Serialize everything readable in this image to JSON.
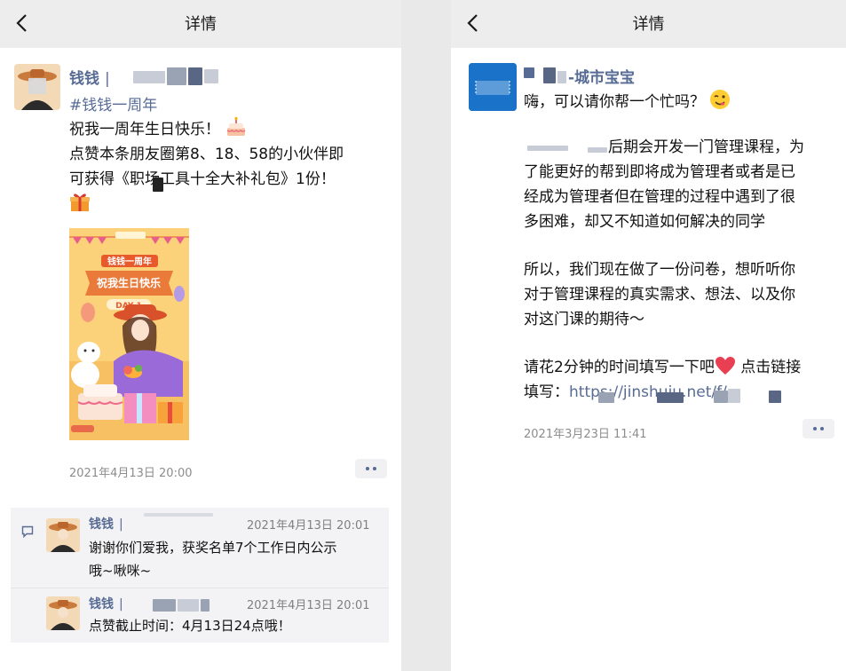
{
  "left": {
    "nav": {
      "title": "详情"
    },
    "post": {
      "author": "钱钱",
      "separator": "|",
      "hashtag": "#钱钱一周年",
      "lines": [
        "祝我一周年生日快乐！",
        "点赞本条朋友圈第8、18、58的小伙伴即",
        "可获得《职场工具十全大补礼包》1份！"
      ],
      "poster": {
        "badge": "钱钱一周年",
        "banner": "祝我生日快乐",
        "day": "DAY 1"
      },
      "time": "2021年4月13日 20:00"
    },
    "comments": [
      {
        "author": "钱钱",
        "separator": "|",
        "time": "2021年4月13日 20:01",
        "lines": [
          "谢谢你们爱我，获奖名单7个工作日内公示",
          "哦~啾咪~"
        ]
      },
      {
        "author": "钱钱",
        "separator": "|",
        "time": "2021年4月13日 20:01",
        "lines": [
          "点赞截止时间：4月13日24点哦！"
        ]
      }
    ]
  },
  "right": {
    "nav": {
      "title": "详情"
    },
    "post": {
      "author_suffix": "-城市宝宝",
      "greeting": "嗨，可以请你帮一个忙吗？",
      "para1": [
        "后期会开发一门管理课程，为",
        "了能更好的帮到即将成为管理者或者是已",
        "经成为管理者但在管理的过程中遇到了很",
        "多困难，却又不知道如何解决的同学"
      ],
      "para2": [
        "所以，我们现在做了一份问卷，想听听你",
        "对于管理课程的真实需求、想法、以及你",
        "对这门课的期待～"
      ],
      "para3_line1": "请花2分钟的时间填写一下吧",
      "para3_line1_end": "点击链接",
      "para3_line2": "填写：",
      "link_text": "https://jinshuju.net/f/",
      "time": "2021年3月23日 11:41"
    }
  },
  "icons": {
    "back": "chevron-left-icon",
    "more": "more-dots-icon",
    "comment": "comment-bubble-icon",
    "cake": "birthday-cake-icon",
    "gift": "gift-icon",
    "wink": "winking-face-icon",
    "heart": "red-heart-icon"
  },
  "colors": {
    "link": "#576b95",
    "nav_bg": "#ededed",
    "comment_bg": "#f3f3f5"
  }
}
